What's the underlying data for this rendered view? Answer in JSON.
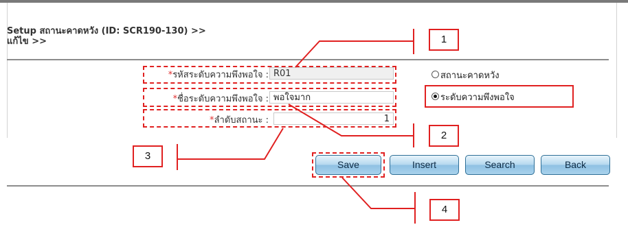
{
  "header": {
    "title_line1": "Setup สถานะคาดหวัง (ID: SCR190-130) >>",
    "title_line2": "แก้ไข >>"
  },
  "form": {
    "required_mark": "*",
    "code": {
      "label": "รหัสระดับความพึงพอใจ :",
      "value": "R01"
    },
    "name": {
      "label": "ชื่อระดับความพึงพอใจ :",
      "value": "พอใจมาก"
    },
    "order": {
      "label": "ลำดับสถานะ :",
      "value": "1"
    }
  },
  "options": {
    "items": [
      {
        "label": "สถานะคาดหวัง",
        "selected": false
      },
      {
        "label": "ระดับความพึงพอใจ",
        "selected": true
      }
    ]
  },
  "buttons": {
    "save": "Save",
    "insert": "Insert",
    "search": "Search",
    "back": "Back"
  },
  "callouts": {
    "c1": "1",
    "c2": "2",
    "c3": "3",
    "c4": "4"
  },
  "colors": {
    "annotation": "#e02020",
    "button_border": "#2d6e96",
    "button_fill": "#a9d2ec"
  }
}
